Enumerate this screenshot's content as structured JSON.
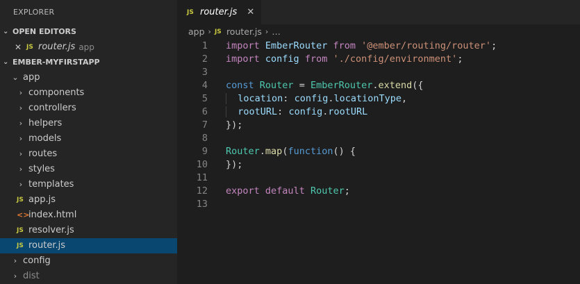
{
  "sidebar": {
    "title": "EXPLORER",
    "open_editors": {
      "header": "OPEN EDITORS",
      "items": [
        {
          "name": "router.js",
          "desc": "app",
          "icon": "JS"
        }
      ]
    },
    "project": {
      "header": "EMBER-MYFIRSTAPP",
      "app_folder": "app",
      "app_children": [
        {
          "name": "components",
          "type": "folder"
        },
        {
          "name": "controllers",
          "type": "folder"
        },
        {
          "name": "helpers",
          "type": "folder"
        },
        {
          "name": "models",
          "type": "folder"
        },
        {
          "name": "routes",
          "type": "folder"
        },
        {
          "name": "styles",
          "type": "folder"
        },
        {
          "name": "templates",
          "type": "folder"
        }
      ],
      "app_files": [
        {
          "name": "app.js",
          "icon": "JS"
        },
        {
          "name": "index.html",
          "icon": "<>"
        },
        {
          "name": "resolver.js",
          "icon": "JS"
        },
        {
          "name": "router.js",
          "icon": "JS"
        }
      ],
      "root_folders": [
        "config",
        "dist"
      ]
    }
  },
  "tab": {
    "label": "router.js",
    "icon": "JS",
    "close": "✕"
  },
  "breadcrumb": {
    "folder": "app",
    "file": "router.js",
    "icon": "JS",
    "more": "…"
  },
  "code": {
    "line_numbers": [
      "1",
      "2",
      "3",
      "4",
      "5",
      "6",
      "7",
      "8",
      "9",
      "10",
      "11",
      "12",
      "13"
    ],
    "tokens": {
      "l1": [
        "import",
        " ",
        "EmberRouter",
        " ",
        "from",
        " ",
        "'@ember/routing/router'",
        ";"
      ],
      "l2": [
        "import",
        " ",
        "config",
        " ",
        "from",
        " ",
        "'./config/environment'",
        ";"
      ],
      "l4": [
        "const",
        " ",
        "Router",
        " = ",
        "EmberRouter",
        ".",
        "extend",
        "({"
      ],
      "l5": [
        "location",
        ": ",
        "config",
        ".",
        "locationType",
        ","
      ],
      "l6": [
        "rootURL",
        ": ",
        "config",
        ".",
        "rootURL"
      ],
      "l7": [
        "});"
      ],
      "l9": [
        "Router",
        ".",
        "map",
        "(",
        "function",
        "() {"
      ],
      "l10": [
        "});"
      ],
      "l12": [
        "export",
        " ",
        "default",
        " ",
        "Router",
        ";"
      ]
    }
  },
  "colors": {
    "sidebar_bg": "#252526",
    "editor_bg": "#1e1e1e",
    "selection": "#094771",
    "js_icon": "#cbcb41",
    "html_icon": "#e37933"
  }
}
